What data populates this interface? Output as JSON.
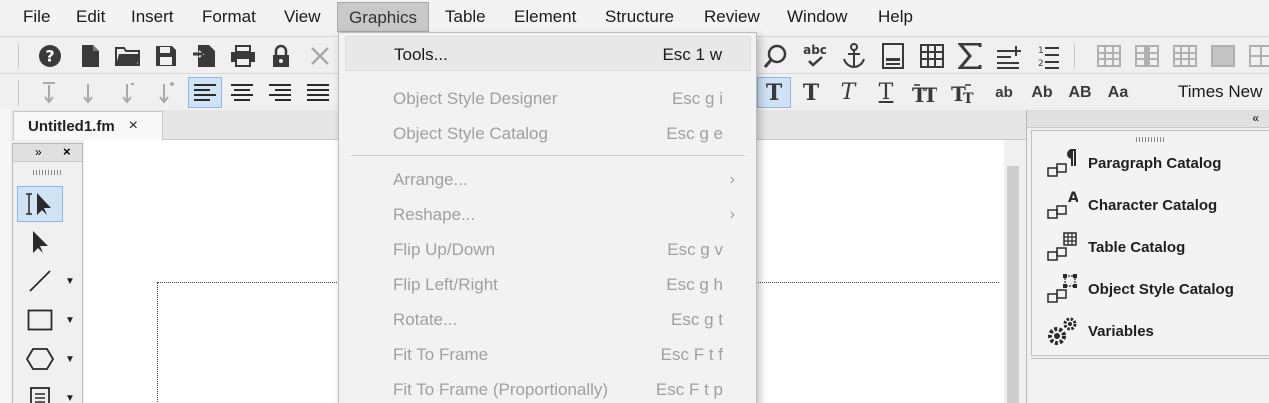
{
  "menubar": {
    "items": [
      "File",
      "Edit",
      "Insert",
      "Format",
      "View",
      "Graphics",
      "Table",
      "Element",
      "Structure",
      "Review",
      "Window",
      "Help"
    ],
    "active": "Graphics"
  },
  "toolbar2": {
    "font_name": "Times New"
  },
  "document": {
    "tab_title": "Untitled1.fm",
    "tab_close": "×"
  },
  "tools_panel": {
    "expand_label": "»",
    "close_label": "×"
  },
  "right_panel": {
    "collapse_label": "«",
    "items": [
      {
        "label": "Paragraph Catalog",
        "icon": "paragraph-catalog-icon"
      },
      {
        "label": "Character Catalog",
        "icon": "character-catalog-icon"
      },
      {
        "label": "Table Catalog",
        "icon": "table-catalog-icon"
      },
      {
        "label": "Object Style Catalog",
        "icon": "object-style-catalog-icon"
      },
      {
        "label": "Variables",
        "icon": "variables-icon"
      }
    ]
  },
  "graphics_menu": {
    "items": [
      {
        "label": "Tools...",
        "shortcut": "Esc 1 w",
        "enabled": true
      },
      {
        "label": "Object Style Designer",
        "shortcut": "Esc g i",
        "enabled": false
      },
      {
        "label": "Object Style Catalog",
        "shortcut": "Esc g e",
        "enabled": false
      },
      {
        "label": "Arrange...",
        "shortcut": "",
        "enabled": false,
        "submenu": true
      },
      {
        "label": "Reshape...",
        "shortcut": "",
        "enabled": false,
        "submenu": true
      },
      {
        "label": "Flip Up/Down",
        "shortcut": "Esc g v",
        "enabled": false
      },
      {
        "label": "Flip Left/Right",
        "shortcut": "Esc g h",
        "enabled": false
      },
      {
        "label": "Rotate...",
        "shortcut": "Esc g t",
        "enabled": false
      },
      {
        "label": "Fit To Frame",
        "shortcut": "Esc F t f",
        "enabled": false
      },
      {
        "label": "Fit To Frame (Proportionally)",
        "shortcut": "Esc F t p",
        "enabled": false
      }
    ],
    "submenu_arrow": "›"
  },
  "colors": {
    "accent_selected": "#cfe2f6",
    "menu_active": "#c9c9c9",
    "disabled_text": "#a0a0a0"
  }
}
